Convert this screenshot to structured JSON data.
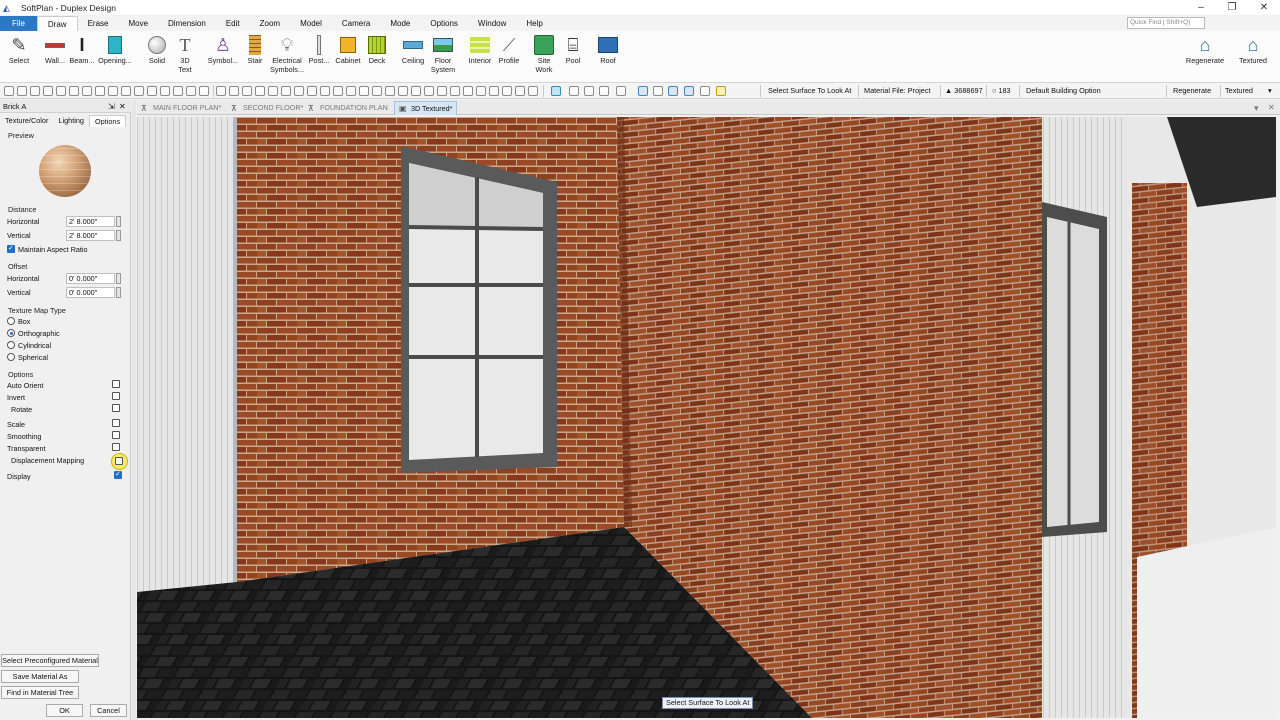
{
  "window": {
    "title": "SoftPlan - Duplex Design",
    "controls": [
      "–",
      "❐",
      "✕"
    ]
  },
  "menubar": {
    "items": [
      "File",
      "Draw",
      "Erase",
      "Move",
      "Dimension",
      "Edit",
      "Zoom",
      "Model",
      "Camera",
      "Mode",
      "Options",
      "Window",
      "Help"
    ],
    "active": "Draw",
    "quick_find_placeholder": "Quick Find | Shift+Q)"
  },
  "ribbon": {
    "buttons": [
      {
        "label": "Select",
        "icon": "pencil-icon"
      },
      {
        "label": "Wall...",
        "icon": "wall-icon"
      },
      {
        "label": "Beam...",
        "icon": "beam-icon"
      },
      {
        "label": "Opening...",
        "icon": "opening-icon"
      },
      {
        "label": "Solid",
        "icon": "solid-icon"
      },
      {
        "label": "3D Text",
        "icon": "text-3d-icon"
      },
      {
        "label": "Symbol...",
        "icon": "symbol-icon"
      },
      {
        "label": "Stair",
        "icon": "stair-icon"
      },
      {
        "label": "Electrical Symbols...",
        "icon": "bulb-icon"
      },
      {
        "label": "Post...",
        "icon": "post-icon"
      },
      {
        "label": "Cabinet",
        "icon": "cabinet-icon"
      },
      {
        "label": "Deck",
        "icon": "deck-icon"
      },
      {
        "label": "Ceiling",
        "icon": "ceiling-icon"
      },
      {
        "label": "Floor System",
        "icon": "floor-system-icon"
      },
      {
        "label": "Interior",
        "icon": "interior-icon"
      },
      {
        "label": "Profile",
        "icon": "profile-icon"
      },
      {
        "label": "Site Work",
        "icon": "site-work-icon"
      },
      {
        "label": "Pool",
        "icon": "pool-icon"
      },
      {
        "label": "Roof",
        "icon": "roof-icon"
      }
    ],
    "right_buttons": [
      {
        "label": "Regenerate",
        "icon": "regenerate-house-icon"
      },
      {
        "label": "Textured",
        "icon": "textured-house-icon"
      }
    ]
  },
  "toolbar2": {
    "select_surface": "Select Surface To Look At",
    "material_file": "Material File: Project",
    "triangle_count": "▲ 3688697",
    "circle_count": "○ 183",
    "building_option": "Default Building Option",
    "regenerate": "Regenerate",
    "render_mode": "Textured"
  },
  "panel": {
    "title": "Brick A",
    "tabs": [
      "Texture/Color",
      "Lighting",
      "Options"
    ],
    "active_tab": "Options",
    "preview_label": "Preview",
    "distance": {
      "label": "Distance",
      "horizontal_label": "Horizontal",
      "horizontal_value": "2' 8.000\"",
      "vertical_label": "Vertical",
      "vertical_value": "2' 8.000\"",
      "maintain_aspect_label": "Maintain Aspect Ratio",
      "maintain_aspect_checked": true
    },
    "offset": {
      "label": "Offset",
      "horizontal_label": "Horizontal",
      "horizontal_value": "0' 0.000\"",
      "vertical_label": "Vertical",
      "vertical_value": "0' 0.000\""
    },
    "texture_map": {
      "label": "Texture Map Type",
      "options": [
        "Box",
        "Orthographic",
        "Cylindrical",
        "Spherical"
      ],
      "selected": "Orthographic"
    },
    "options": {
      "label": "Options",
      "items": [
        {
          "label": "Auto Orient",
          "checked": false
        },
        {
          "label": "Invert",
          "checked": false
        },
        {
          "label": "Rotate",
          "checked": false
        },
        {
          "label": "Scale",
          "checked": false
        },
        {
          "label": "Smoothing",
          "checked": false
        },
        {
          "label": "Transparent",
          "checked": false
        },
        {
          "label": "Displacement Mapping",
          "checked": false
        },
        {
          "label": "Display",
          "checked": true
        }
      ]
    },
    "buttons": {
      "preconfigured": "Select Preconfigured Material",
      "save_as": "Save Material As",
      "find_tree": "Find in Material Tree",
      "ok": "OK",
      "cancel": "Cancel"
    }
  },
  "doc_tabs": [
    {
      "label": "MAIN FLOOR PLAN*",
      "active": false
    },
    {
      "label": "SECOND FLOOR*",
      "active": false
    },
    {
      "label": "FOUNDATION PLAN",
      "active": false
    },
    {
      "label": "3D Textured*",
      "active": true
    }
  ],
  "viewport": {
    "status_tip": "Select Surface To Look At",
    "colors": {
      "brick": "#8e4020",
      "mortar": "#c9a98d",
      "floor": "#1c1c1c",
      "window_frame": "#5a5a5a",
      "wall_white": "#ececec"
    }
  }
}
